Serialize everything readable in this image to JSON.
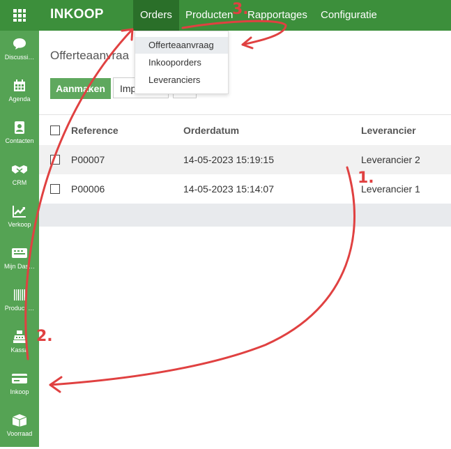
{
  "topbar": {
    "app_title": "INKOOP",
    "menu": [
      {
        "label": "Orders",
        "active": true
      },
      {
        "label": "Producten",
        "active": false
      },
      {
        "label": "Rapportages",
        "active": false
      },
      {
        "label": "Configuratie",
        "active": false
      }
    ]
  },
  "sidebar": {
    "items": [
      {
        "label": "Discussi…",
        "icon": "chat-icon"
      },
      {
        "label": "Agenda",
        "icon": "calendar-icon"
      },
      {
        "label": "Contacten",
        "icon": "contacts-icon"
      },
      {
        "label": "CRM",
        "icon": "handshake-icon"
      },
      {
        "label": "Verkoop",
        "icon": "trend-chart-icon"
      },
      {
        "label": "Mijn Das…",
        "icon": "dashboard-icon"
      },
      {
        "label": "Product …",
        "icon": "barcode-icon"
      },
      {
        "label": "Kassa",
        "icon": "cash-register-icon"
      },
      {
        "label": "Inkoop",
        "icon": "credit-card-icon"
      },
      {
        "label": "Voorraad",
        "icon": "box-icon"
      }
    ]
  },
  "dropdown": {
    "items": [
      {
        "label": "Offerteaanvraag",
        "highlighted": true
      },
      {
        "label": "Inkooporders",
        "highlighted": false
      },
      {
        "label": "Leveranciers",
        "highlighted": false
      }
    ]
  },
  "page": {
    "title": "Offerteaanvraa",
    "create_button": "Aanmaken",
    "import_button": "Imp"
  },
  "table": {
    "columns": [
      "Reference",
      "Orderdatum",
      "Leverancier"
    ],
    "rows": [
      {
        "reference": "P00007",
        "date": "14-05-2023 15:19:15",
        "supplier": "Leverancier 2"
      },
      {
        "reference": "P00006",
        "date": "14-05-2023 15:14:07",
        "supplier": "Leverancier 1"
      }
    ]
  },
  "annotations": {
    "step1": "1.",
    "step2": "2.",
    "step3": "3.",
    "color": "#e04141"
  },
  "colors": {
    "topbar": "#3c8f3b",
    "active_menu": "#2a6f29",
    "sidebar": "#55a354",
    "primary_button": "#5fa85e"
  }
}
